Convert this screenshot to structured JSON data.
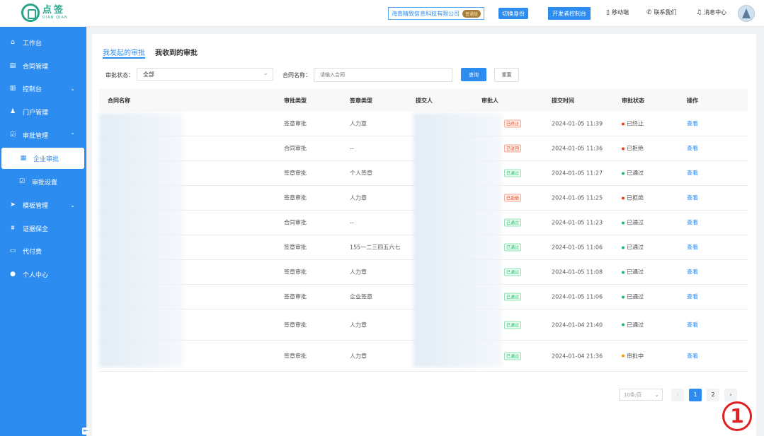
{
  "header": {
    "logo_title": "点签",
    "logo_subtitle": "DIAN QIAN",
    "company": "海南精致信息科技有限公司",
    "vip_badge": "普通版",
    "switch_label": "切换身份",
    "dev_label": "开发者控制台",
    "links": [
      {
        "label": "移动端",
        "icon": "mobile-icon"
      },
      {
        "label": "联系我们",
        "icon": "phone-icon"
      },
      {
        "label": "消息中心",
        "icon": "bell-icon"
      }
    ]
  },
  "sidebar": {
    "items": [
      {
        "label": "工作台",
        "icon": "home-icon"
      },
      {
        "label": "合同管理",
        "icon": "file-icon"
      },
      {
        "label": "控制台",
        "icon": "chart-icon",
        "arrow": "⌄"
      },
      {
        "label": "门户管理",
        "icon": "user-icon"
      },
      {
        "label": "审批管理",
        "icon": "check-icon",
        "arrow": "⌃"
      },
      {
        "label": "企业审批",
        "icon": "building-icon",
        "active": true
      },
      {
        "label": "审批设置",
        "icon": "checkbox-icon"
      },
      {
        "label": "模板管理",
        "icon": "send-icon",
        "arrow": "⌄"
      },
      {
        "label": "证据保全",
        "icon": "bank-icon"
      },
      {
        "label": "代付费",
        "icon": "wallet-icon"
      },
      {
        "label": "个人中心",
        "icon": "person-icon"
      }
    ]
  },
  "tabs": [
    "我发起的审批",
    "我收到的审批"
  ],
  "filters": {
    "status_label": "审批状态：",
    "status_value": "全部",
    "name_label": "合同名称：",
    "name_placeholder": "请输入合同",
    "search_label": "查询",
    "reset_label": "重置"
  },
  "table": {
    "columns": [
      "合同名称",
      "审批类型",
      "签章类型",
      "提交人",
      "审批人",
      "提交时间",
      "审批状态",
      "操作"
    ],
    "rows": [
      {
        "type": "签章审批",
        "seal": "人力章",
        "tag": "已终止",
        "tag_color": "red",
        "time": "2024-01-05 11:39",
        "status": "已终止",
        "dot": "#ed4014",
        "action": "查看"
      },
      {
        "type": "合同审批",
        "seal": "--",
        "tag": "已驳回",
        "tag_color": "red",
        "time": "2024-01-05 11:36",
        "status": "已拒绝",
        "dot": "#ed4014",
        "action": "查看"
      },
      {
        "type": "签章审批",
        "seal": "个人签章",
        "tag": "已通过",
        "tag_color": "green",
        "time": "2024-01-05 11:27",
        "status": "已通过",
        "dot": "#19be6b",
        "action": "查看"
      },
      {
        "type": "签章审批",
        "seal": "人力章",
        "tag": "已拒绝",
        "tag_color": "red",
        "time": "2024-01-05 11:25",
        "status": "已拒绝",
        "dot": "#ed4014",
        "action": "查看"
      },
      {
        "type": "合同审批",
        "seal": "--",
        "tag": "已通过",
        "tag_color": "green",
        "time": "2024-01-05 11:23",
        "status": "已通过",
        "dot": "#19be6b",
        "action": "查看"
      },
      {
        "type": "签章审批",
        "seal": "155一二三四五六七",
        "tag": "已通过",
        "tag_color": "green",
        "time": "2024-01-05 11:06",
        "status": "已通过",
        "dot": "#19be6b",
        "action": "查看"
      },
      {
        "type": "签章审批",
        "seal": "人力章",
        "tag": "已通过",
        "tag_color": "green",
        "time": "2024-01-05 11:08",
        "status": "已通过",
        "dot": "#19be6b",
        "action": "查看"
      },
      {
        "type": "签章审批",
        "seal": "企业签章",
        "tag": "已通过",
        "tag_color": "green",
        "time": "2024-01-05 11:06",
        "status": "已通过",
        "dot": "#19be6b",
        "action": "查看"
      },
      {
        "type": "签章审批",
        "seal": "人力章",
        "tag": "已通过",
        "tag_color": "green",
        "time": "2024-01-04 21:40",
        "status": "已通过",
        "dot": "#19be6b",
        "action": "查看"
      },
      {
        "type": "签章审批",
        "seal": "人力章",
        "tag": "已通过",
        "tag_color": "green",
        "time": "2024-01-04 21:36",
        "status": "审批中",
        "dot": "#ff9900",
        "action": "查看"
      }
    ]
  },
  "pagination": {
    "page_size": "10条/页",
    "pages": [
      "1",
      "2"
    ],
    "current": "1"
  },
  "annotation": "1"
}
